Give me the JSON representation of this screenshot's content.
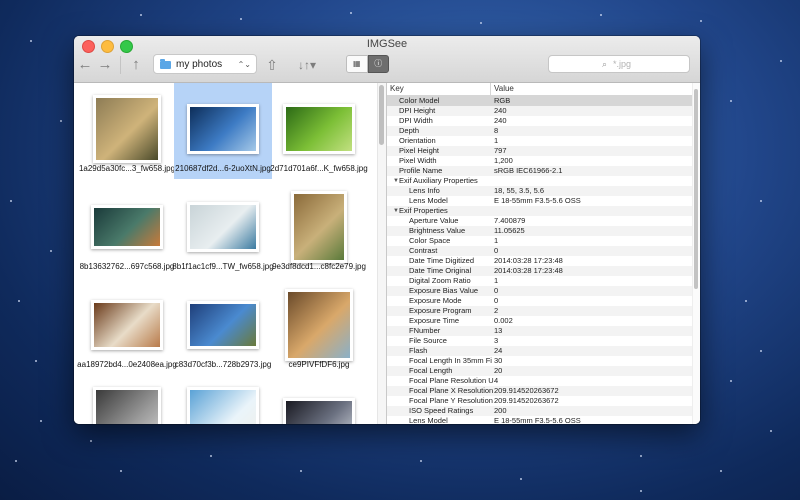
{
  "window": {
    "title": "IMGSee"
  },
  "toolbar": {
    "back_icon": "←",
    "forward_icon": "→",
    "up_icon": "↑",
    "path_label": "my photos",
    "path_arrows": "⌃⌄",
    "share_icon": "⇧",
    "sort_icon": "↓↑▾",
    "grid_icon": "▦",
    "info_icon": "ⓘ",
    "search_placeholder": "*.jpg",
    "search_icon_glyph": "⌕"
  },
  "files": [
    {
      "name": "1a29d5a30fc...3_fw658.jpg",
      "colors": [
        "#8d7c55",
        "#cfb37a",
        "#4a4a2a"
      ],
      "w": 68,
      "h": 68
    },
    {
      "name": "210687df2d...6-2uoXtN.jpg",
      "colors": [
        "#0d2e5a",
        "#3d7bc4",
        "#a5c9e8"
      ],
      "w": 72,
      "h": 50,
      "selected": true
    },
    {
      "name": "2d71d701a6f...K_fw658.jpg",
      "colors": [
        "#2c6a16",
        "#7cbf36",
        "#c2e081"
      ],
      "w": 72,
      "h": 50
    },
    {
      "name": "8b13632762...697c568.jpg",
      "colors": [
        "#1a3a3a",
        "#4a7a6a",
        "#c87a3a"
      ],
      "w": 72,
      "h": 44
    },
    {
      "name": "8b1f1ac1cf9...TW_fw658.jpg",
      "colors": [
        "#c9d4d8",
        "#e8eef0",
        "#3a7aa0"
      ],
      "w": 72,
      "h": 50
    },
    {
      "name": "9e3df8dcd1...c8fc2e79.jpg",
      "colors": [
        "#8a6a3a",
        "#c9b07a",
        "#5a7a3a"
      ],
      "w": 56,
      "h": 72
    },
    {
      "name": "aa18972bd4...0e2408ea.jpg",
      "colors": [
        "#6a3a1a",
        "#e8dcc8",
        "#b87a4a"
      ],
      "w": 72,
      "h": 50
    },
    {
      "name": "c83d70cf3b...728b2973.jpg",
      "colors": [
        "#1f3f7a",
        "#4a8ad0",
        "#6a7a3a"
      ],
      "w": 72,
      "h": 48
    },
    {
      "name": "ce9PIVFfDF6.jpg",
      "colors": [
        "#6a4a2a",
        "#d9a86a",
        "#8ab0c8"
      ],
      "w": 68,
      "h": 72
    },
    {
      "name": "",
      "colors": [
        "#3a3a3a",
        "#9a9a9a",
        "#e0e0e0"
      ],
      "w": 68,
      "h": 72
    },
    {
      "name": "",
      "colors": [
        "#5aa2d6",
        "#eaf4fa",
        "#f2efe4"
      ],
      "w": 72,
      "h": 72
    },
    {
      "name": "",
      "colors": [
        "#1a1a22",
        "#6a7080",
        "#d0d4dc"
      ],
      "w": 72,
      "h": 50
    }
  ],
  "inspector": {
    "col_key": "Key",
    "col_value": "Value",
    "rows": [
      {
        "key": "Color Model",
        "value": "RGB",
        "level": 1,
        "sel": true
      },
      {
        "key": "DPI Height",
        "value": "240",
        "level": 1
      },
      {
        "key": "DPI Width",
        "value": "240",
        "level": 1
      },
      {
        "key": "Depth",
        "value": "8",
        "level": 1
      },
      {
        "key": "Orientation",
        "value": "1",
        "level": 1
      },
      {
        "key": "Pixel Height",
        "value": "797",
        "level": 1
      },
      {
        "key": "Pixel Width",
        "value": "1,200",
        "level": 1
      },
      {
        "key": "Profile Name",
        "value": "sRGB IEC61966-2.1",
        "level": 1
      },
      {
        "key": "Exif Auxiliary Properties",
        "value": "",
        "level": 0,
        "group": true
      },
      {
        "key": "Lens Info",
        "value": "18, 55, 3.5, 5.6",
        "level": 2
      },
      {
        "key": "Lens Model",
        "value": "E 18-55mm F3.5-5.6 OSS",
        "level": 2
      },
      {
        "key": "Exif Properties",
        "value": "",
        "level": 0,
        "group": true
      },
      {
        "key": "Aperture Value",
        "value": "7.400879",
        "level": 2
      },
      {
        "key": "Brightness Value",
        "value": "11.05625",
        "level": 2
      },
      {
        "key": "Color Space",
        "value": "1",
        "level": 2
      },
      {
        "key": "Contrast",
        "value": "0",
        "level": 2
      },
      {
        "key": "Date Time Digitized",
        "value": "2014:03:28 17:23:48",
        "level": 2
      },
      {
        "key": "Date Time Original",
        "value": "2014:03:28 17:23:48",
        "level": 2
      },
      {
        "key": "Digital Zoom Ratio",
        "value": "1",
        "level": 2
      },
      {
        "key": "Exposure Bias Value",
        "value": "0",
        "level": 2
      },
      {
        "key": "Exposure Mode",
        "value": "0",
        "level": 2
      },
      {
        "key": "Exposure Program",
        "value": "2",
        "level": 2
      },
      {
        "key": "Exposure Time",
        "value": "0.002",
        "level": 2
      },
      {
        "key": "FNumber",
        "value": "13",
        "level": 2
      },
      {
        "key": "File Source",
        "value": "3",
        "level": 2
      },
      {
        "key": "Flash",
        "value": "24",
        "level": 2
      },
      {
        "key": "Focal Length In 35mm Fi",
        "value": "30",
        "level": 2
      },
      {
        "key": "Focal Length",
        "value": "20",
        "level": 2
      },
      {
        "key": "Focal Plane Resolution U",
        "value": "4",
        "level": 2
      },
      {
        "key": "Focal Plane X Resolution",
        "value": "209.914520263672",
        "level": 2
      },
      {
        "key": "Focal Plane Y Resolution",
        "value": "209.914520263672",
        "level": 2
      },
      {
        "key": "ISO Speed Ratings",
        "value": "200",
        "level": 2
      },
      {
        "key": "Lens Model",
        "value": "E 18-55mm F3.5-5.6 OSS",
        "level": 2
      }
    ]
  }
}
